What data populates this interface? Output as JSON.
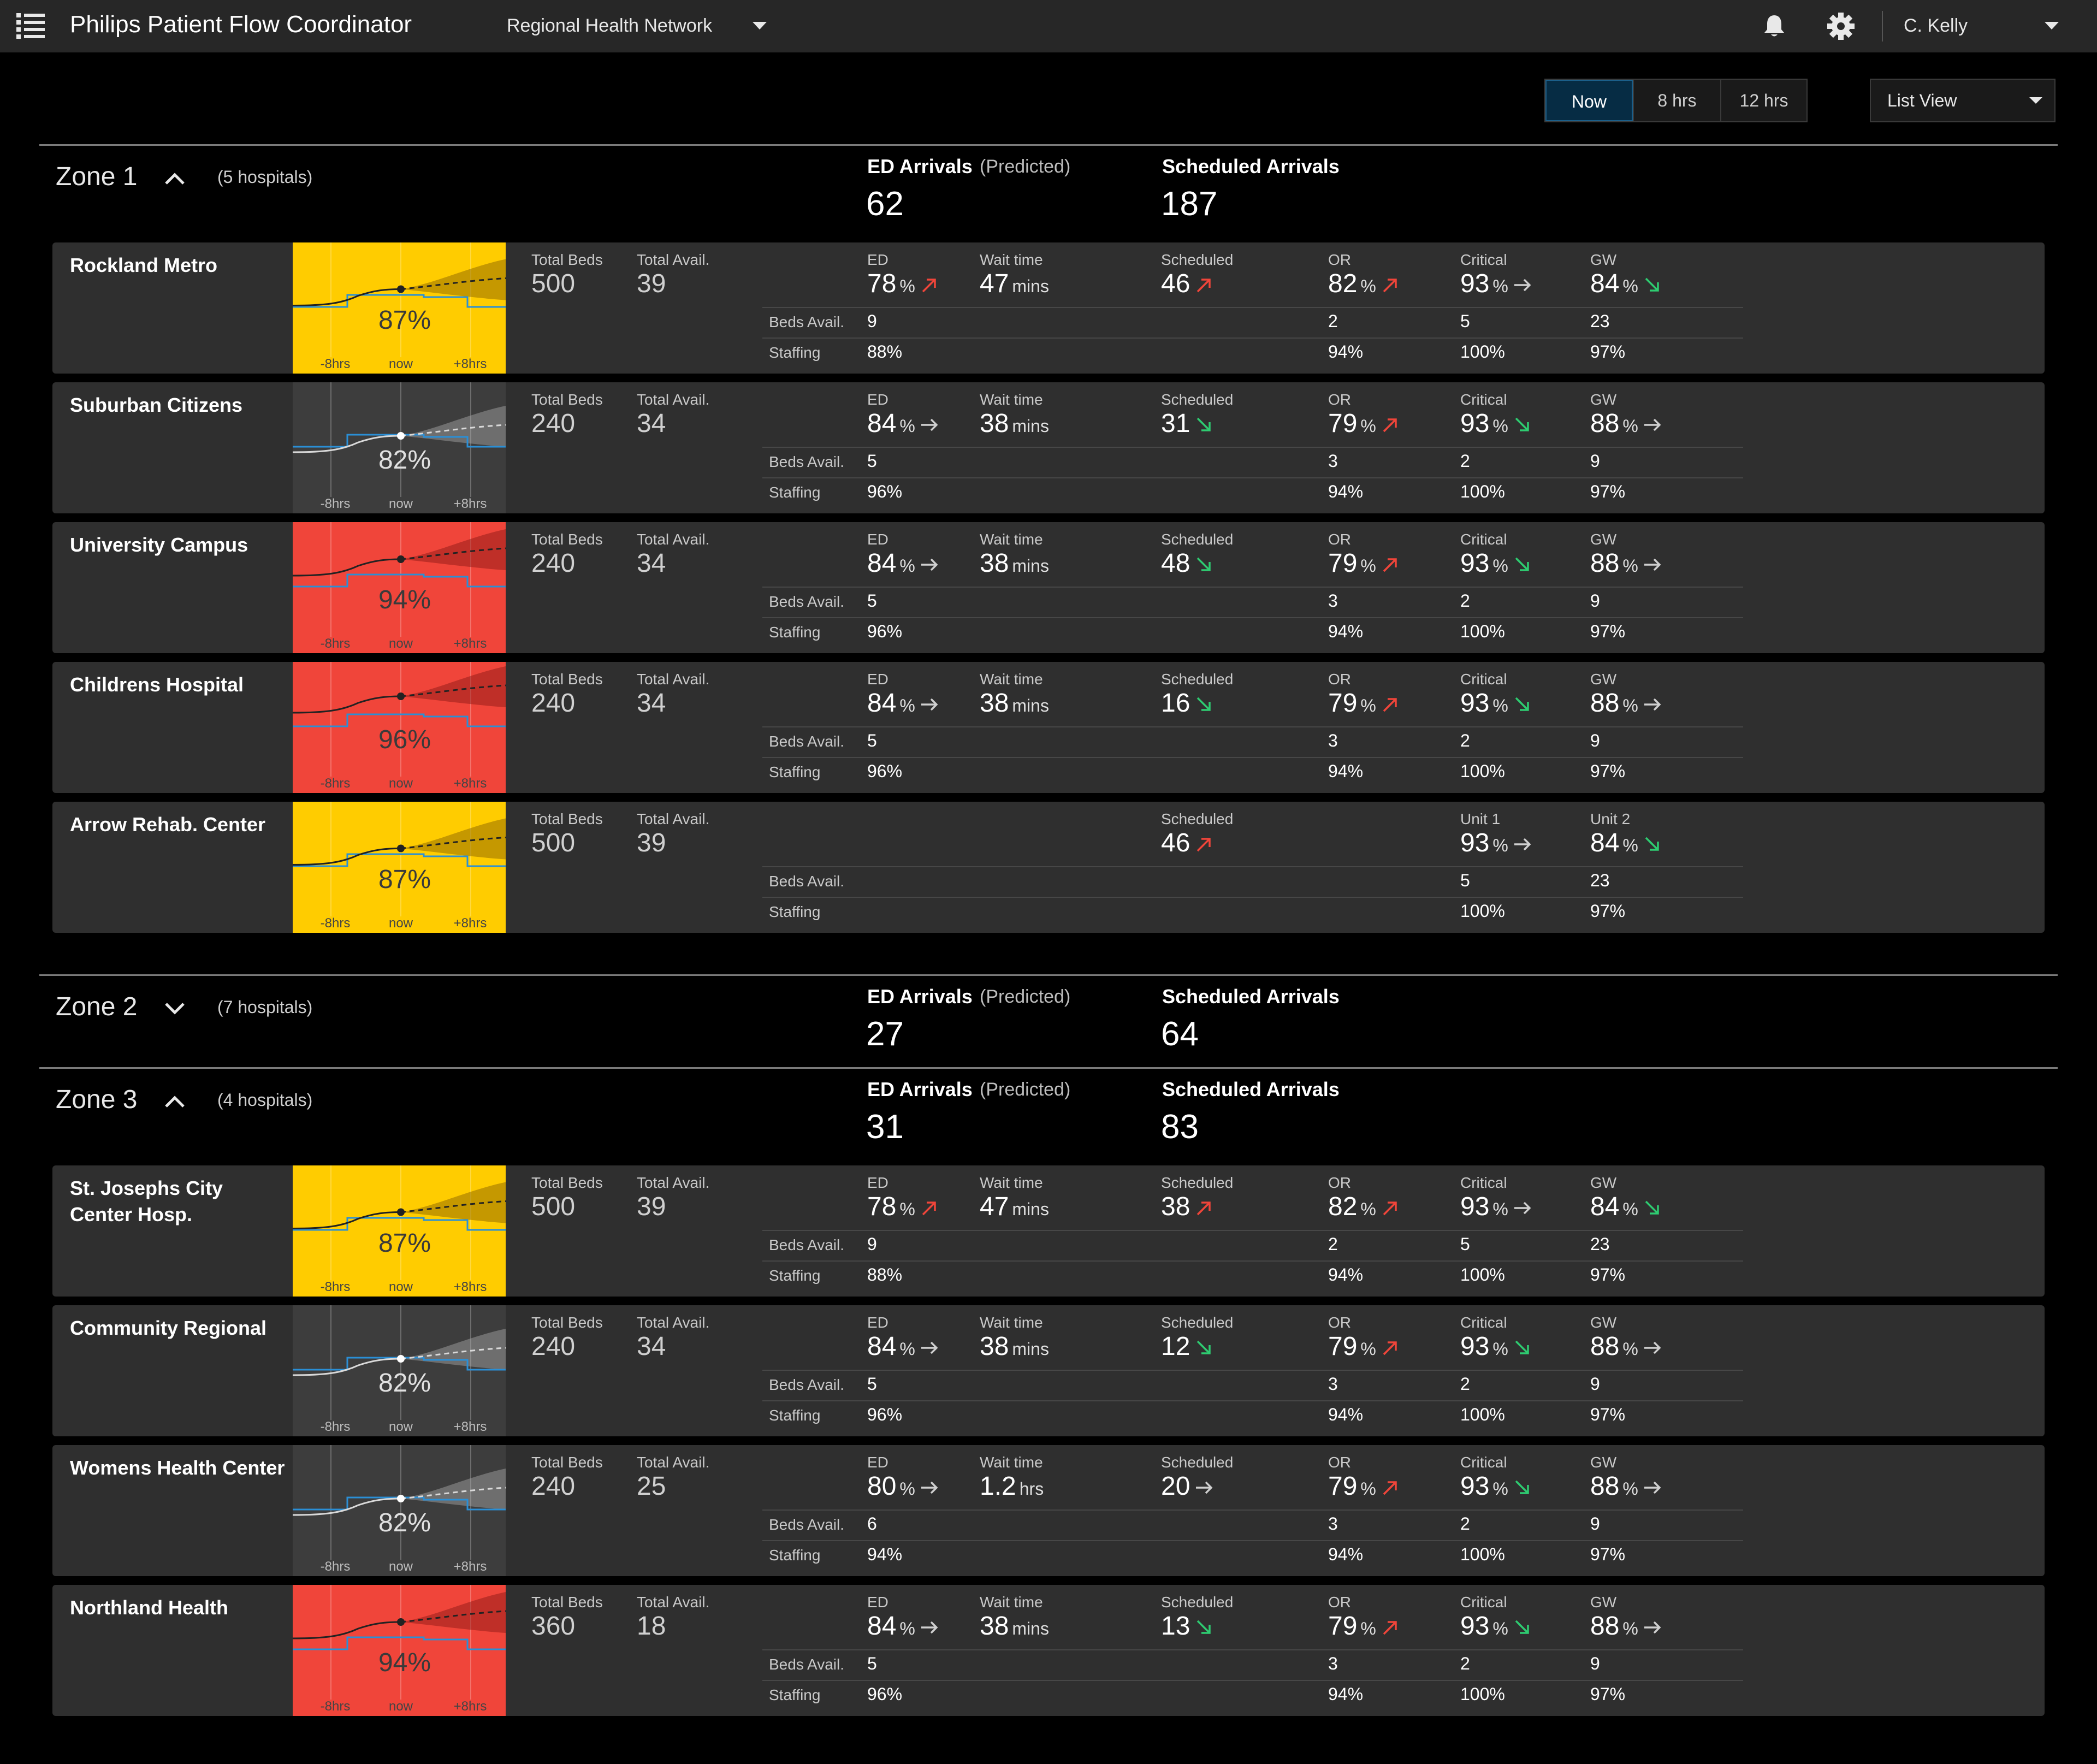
{
  "app": {
    "title": "Philips Patient Flow Coordinator",
    "network": "Regional Health Network",
    "user": "C. Kelly"
  },
  "toolbar": {
    "time_options": [
      "Now",
      "8 hrs",
      "12 hrs"
    ],
    "active_time": "Now",
    "view_select": "List View"
  },
  "colors": {
    "yellow": "#ffcc00",
    "red": "#f0453a",
    "gray": "#3d3d3d",
    "up_arrow": "#f0453a",
    "down_arrow": "#2ecc71",
    "flat_arrow": "#cfcfcf",
    "card_bg": "#2f2f2f",
    "active_segment": "#062c44"
  },
  "labels": {
    "ed_arrivals": "ED Arrivals",
    "predicted": "(Predicted)",
    "scheduled_arrivals": "Scheduled Arrivals",
    "total_beds": "Total Beds",
    "total_avail": "Total Avail.",
    "beds_avail": "Beds Avail.",
    "staffing": "Staffing",
    "ed": "ED",
    "wait_time": "Wait time",
    "scheduled": "Scheduled",
    "spark_minus": "-8hrs",
    "spark_now": "now",
    "spark_plus": "+8hrs",
    "pct": "%"
  },
  "zones": [
    {
      "name": "Zone 1",
      "count": "(5 hospitals)",
      "expanded": true,
      "ed_arrivals": "62",
      "scheduled_arrivals": "187",
      "hospitals": [
        {
          "name": "Rockland Metro",
          "status": "yellow",
          "occupancy": "87%",
          "total_beds": "500",
          "total_avail": "39",
          "ed": {
            "value": "78",
            "trend": "up"
          },
          "wait": {
            "value": "47",
            "unit": "mins"
          },
          "scheduled": {
            "value": "46",
            "trend": "up"
          },
          "units": [
            {
              "label": "OR",
              "value": "82",
              "trend": "up",
              "beds": "2",
              "staffing": "94%"
            },
            {
              "label": "Critical",
              "value": "93",
              "trend": "flat",
              "beds": "5",
              "staffing": "100%"
            },
            {
              "label": "GW",
              "value": "84",
              "trend": "down",
              "beds": "23",
              "staffing": "97%"
            }
          ],
          "ed_beds": "9",
          "ed_staffing": "88%"
        },
        {
          "name": "Suburban Citizens",
          "status": "gray",
          "occupancy": "82%",
          "total_beds": "240",
          "total_avail": "34",
          "ed": {
            "value": "84",
            "trend": "flat"
          },
          "wait": {
            "value": "38",
            "unit": "mins"
          },
          "scheduled": {
            "value": "31",
            "trend": "down"
          },
          "units": [
            {
              "label": "OR",
              "value": "79",
              "trend": "up",
              "beds": "3",
              "staffing": "94%"
            },
            {
              "label": "Critical",
              "value": "93",
              "trend": "down",
              "beds": "2",
              "staffing": "100%"
            },
            {
              "label": "GW",
              "value": "88",
              "trend": "flat",
              "beds": "9",
              "staffing": "97%"
            }
          ],
          "ed_beds": "5",
          "ed_staffing": "96%"
        },
        {
          "name": "University Campus",
          "status": "red",
          "occupancy": "94%",
          "total_beds": "240",
          "total_avail": "34",
          "ed": {
            "value": "84",
            "trend": "flat"
          },
          "wait": {
            "value": "38",
            "unit": "mins"
          },
          "scheduled": {
            "value": "48",
            "trend": "down"
          },
          "units": [
            {
              "label": "OR",
              "value": "79",
              "trend": "up",
              "beds": "3",
              "staffing": "94%"
            },
            {
              "label": "Critical",
              "value": "93",
              "trend": "down",
              "beds": "2",
              "staffing": "100%"
            },
            {
              "label": "GW",
              "value": "88",
              "trend": "flat",
              "beds": "9",
              "staffing": "97%"
            }
          ],
          "ed_beds": "5",
          "ed_staffing": "96%"
        },
        {
          "name": "Childrens Hospital",
          "status": "red",
          "occupancy": "96%",
          "total_beds": "240",
          "total_avail": "34",
          "ed": {
            "value": "84",
            "trend": "flat"
          },
          "wait": {
            "value": "38",
            "unit": "mins"
          },
          "scheduled": {
            "value": "16",
            "trend": "down"
          },
          "units": [
            {
              "label": "OR",
              "value": "79",
              "trend": "up",
              "beds": "3",
              "staffing": "94%"
            },
            {
              "label": "Critical",
              "value": "93",
              "trend": "down",
              "beds": "2",
              "staffing": "100%"
            },
            {
              "label": "GW",
              "value": "88",
              "trend": "flat",
              "beds": "9",
              "staffing": "97%"
            }
          ],
          "ed_beds": "5",
          "ed_staffing": "96%"
        },
        {
          "name": "Arrow Rehab. Center",
          "status": "yellow",
          "occupancy": "87%",
          "total_beds": "500",
          "total_avail": "39",
          "ed": null,
          "wait": null,
          "scheduled": {
            "value": "46",
            "trend": "up"
          },
          "units": [
            null,
            {
              "label": "Unit 1",
              "value": "93",
              "trend": "flat",
              "beds": "5",
              "staffing": "100%"
            },
            {
              "label": "Unit 2",
              "value": "84",
              "trend": "down",
              "beds": "23",
              "staffing": "97%"
            }
          ],
          "ed_beds": "",
          "ed_staffing": ""
        }
      ]
    },
    {
      "name": "Zone 2",
      "count": "(7 hospitals)",
      "expanded": false,
      "ed_arrivals": "27",
      "scheduled_arrivals": "64",
      "hospitals": []
    },
    {
      "name": "Zone 3",
      "count": "(4 hospitals)",
      "expanded": true,
      "ed_arrivals": "31",
      "scheduled_arrivals": "83",
      "hospitals": [
        {
          "name": "St. Josephs City Center Hosp.",
          "status": "yellow",
          "occupancy": "87%",
          "total_beds": "500",
          "total_avail": "39",
          "ed": {
            "value": "78",
            "trend": "up"
          },
          "wait": {
            "value": "47",
            "unit": "mins"
          },
          "scheduled": {
            "value": "38",
            "trend": "up"
          },
          "units": [
            {
              "label": "OR",
              "value": "82",
              "trend": "up",
              "beds": "2",
              "staffing": "94%"
            },
            {
              "label": "Critical",
              "value": "93",
              "trend": "flat",
              "beds": "5",
              "staffing": "100%"
            },
            {
              "label": "GW",
              "value": "84",
              "trend": "down",
              "beds": "23",
              "staffing": "97%"
            }
          ],
          "ed_beds": "9",
          "ed_staffing": "88%"
        },
        {
          "name": "Community Regional",
          "status": "gray",
          "occupancy": "82%",
          "total_beds": "240",
          "total_avail": "34",
          "ed": {
            "value": "84",
            "trend": "flat"
          },
          "wait": {
            "value": "38",
            "unit": "mins"
          },
          "scheduled": {
            "value": "12",
            "trend": "down"
          },
          "units": [
            {
              "label": "OR",
              "value": "79",
              "trend": "up",
              "beds": "3",
              "staffing": "94%"
            },
            {
              "label": "Critical",
              "value": "93",
              "trend": "down",
              "beds": "2",
              "staffing": "100%"
            },
            {
              "label": "GW",
              "value": "88",
              "trend": "flat",
              "beds": "9",
              "staffing": "97%"
            }
          ],
          "ed_beds": "5",
          "ed_staffing": "96%"
        },
        {
          "name": "Womens Health Center",
          "status": "gray",
          "occupancy": "82%",
          "total_beds": "240",
          "total_avail": "25",
          "ed": {
            "value": "80",
            "trend": "flat"
          },
          "wait": {
            "value": "1.2",
            "unit": "hrs"
          },
          "scheduled": {
            "value": "20",
            "trend": "flat"
          },
          "units": [
            {
              "label": "OR",
              "value": "79",
              "trend": "up",
              "beds": "3",
              "staffing": "94%"
            },
            {
              "label": "Critical",
              "value": "93",
              "trend": "down",
              "beds": "2",
              "staffing": "100%"
            },
            {
              "label": "GW",
              "value": "88",
              "trend": "flat",
              "beds": "9",
              "staffing": "97%"
            }
          ],
          "ed_beds": "6",
          "ed_staffing": "94%"
        },
        {
          "name": "Northland Health",
          "status": "red",
          "occupancy": "94%",
          "total_beds": "360",
          "total_avail": "18",
          "ed": {
            "value": "84",
            "trend": "flat"
          },
          "wait": {
            "value": "38",
            "unit": "mins"
          },
          "scheduled": {
            "value": "13",
            "trend": "down"
          },
          "units": [
            {
              "label": "OR",
              "value": "79",
              "trend": "up",
              "beds": "3",
              "staffing": "94%"
            },
            {
              "label": "Critical",
              "value": "93",
              "trend": "down",
              "beds": "2",
              "staffing": "100%"
            },
            {
              "label": "GW",
              "value": "88",
              "trend": "flat",
              "beds": "9",
              "staffing": "97%"
            }
          ],
          "ed_beds": "5",
          "ed_staffing": "96%"
        }
      ]
    }
  ]
}
